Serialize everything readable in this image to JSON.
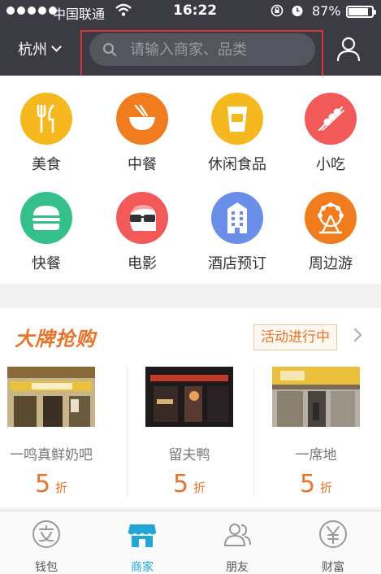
{
  "status": {
    "carrier": "中国联通",
    "time": "16:22",
    "battery": "87%",
    "battery_level": 0.87
  },
  "header": {
    "city": "杭州",
    "search_placeholder": "请输入商家、品类"
  },
  "categories": [
    {
      "label": "美食",
      "icon": "fork-knife-icon",
      "color": "#f5b91f"
    },
    {
      "label": "中餐",
      "icon": "bowl-chopsticks-icon",
      "color": "#f07c1e"
    },
    {
      "label": "休闲食品",
      "icon": "drink-cup-icon",
      "color": "#f5b91f"
    },
    {
      "label": "小吃",
      "icon": "skewer-icon",
      "color": "#f25a5a"
    },
    {
      "label": "快餐",
      "icon": "burger-icon",
      "color": "#35c08b"
    },
    {
      "label": "电影",
      "icon": "glasses-face-icon",
      "color": "#f25a5a"
    },
    {
      "label": "酒店预订",
      "icon": "hotel-building-icon",
      "color": "#6b8fe8"
    },
    {
      "label": "周边游",
      "icon": "ferris-wheel-icon",
      "color": "#f07c1e"
    }
  ],
  "flash_sale": {
    "title": "大牌抢购",
    "tag": "活动进行中",
    "shops": [
      {
        "name": "一鸣真鲜奶吧",
        "discount": "5",
        "unit": "折"
      },
      {
        "name": "留夫鸭",
        "discount": "5",
        "unit": "折"
      },
      {
        "name": "一席地",
        "discount": "5",
        "unit": "折"
      }
    ]
  },
  "tabs": [
    {
      "label": "钱包",
      "icon": "wallet-icon"
    },
    {
      "label": "商家",
      "icon": "store-icon",
      "active": true
    },
    {
      "label": "朋友",
      "icon": "friends-icon"
    },
    {
      "label": "财富",
      "icon": "yen-icon"
    }
  ],
  "colors": {
    "header_bg": "#3b3b44",
    "accent_orange": "#e8732b",
    "active_tab": "#22a6d8",
    "highlight_frame": "#d9363a"
  }
}
